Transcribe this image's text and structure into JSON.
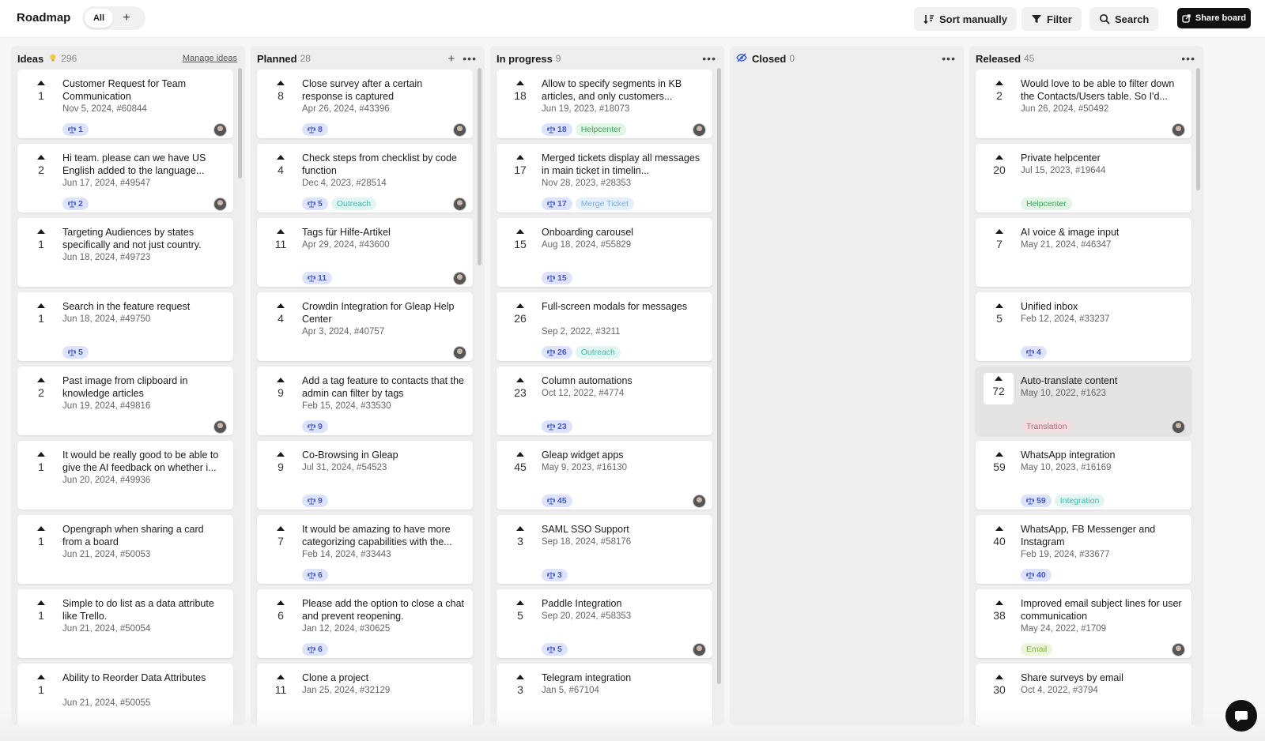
{
  "app": {
    "title": "Roadmap",
    "filter_all": "All",
    "add_symbol": "+",
    "sort_label": "Sort manually",
    "filter_label": "Filter",
    "search_label": "Search",
    "share_label": "Share board"
  },
  "colors": {
    "chip_bg": "#dde3fb",
    "chip_text": "#4358c9",
    "share_bg": "#111111"
  },
  "columns": [
    {
      "name": "Ideas",
      "count": "296",
      "manage_label": "Manage ideas",
      "cards": [
        {
          "votes": "1",
          "title": "Customer Request for Team Communication",
          "meta": "Nov 5, 2024, #60844",
          "chip": "1",
          "avatar": true
        },
        {
          "votes": "2",
          "title": "Hi team. please can we have US English added to the language...",
          "meta": "Jun 17, 2024, #49547",
          "chip": "2",
          "avatar": true
        },
        {
          "votes": "1",
          "title": "Targeting Audiences by states specifically and not just country.",
          "meta": "Jun 18, 2024, #49723"
        },
        {
          "votes": "1",
          "title": "Search in the feature request",
          "meta": "Jun 18, 2024, #49750",
          "chip": "5"
        },
        {
          "votes": "2",
          "title": "Past image from clipboard in knowledge articles",
          "meta": "Jun 19, 2024, #49816",
          "avatar": true
        },
        {
          "votes": "1",
          "title": "It would be really good to be able to give the AI feedback on whether i...",
          "meta": "Jun 20, 2024, #49936"
        },
        {
          "votes": "1",
          "title": "Opengraph when sharing a card from a board",
          "meta": "Jun 21, 2024, #50053"
        },
        {
          "votes": "1",
          "title": "Simple to do list as a data attribute like Trello.",
          "meta": "Jun 21, 2024, #50054"
        },
        {
          "votes": "1",
          "title": "Ability to Reorder Data Attributes",
          "meta": "Jun 21, 2024, #50055"
        }
      ]
    },
    {
      "name": "Planned",
      "count": "28",
      "cards": [
        {
          "votes": "8",
          "title": "Close survey after a certain response is captured",
          "meta": "Apr 26, 2024, #43396",
          "chip": "8",
          "avatar": true
        },
        {
          "votes": "4",
          "title": "Check steps from checklist by code function",
          "meta": "Dec 4, 2023, #28514",
          "chip": "5",
          "tag": "Outreach",
          "tag_color": "#3fb8a8",
          "tag_bg": "#e3f5f2",
          "avatar": true
        },
        {
          "votes": "11",
          "title": "Tags für Hilfe-Artikel",
          "meta": "Apr 29, 2024, #43600",
          "chip": "11",
          "avatar": true
        },
        {
          "votes": "4",
          "title": "Crowdin Integration for Gleap Help Center",
          "meta": "Apr 3, 2024, #40757",
          "avatar": true
        },
        {
          "votes": "9",
          "title": "Add a tag feature to contacts that the admin can filter by tags",
          "meta": "Feb 15, 2024, #33530",
          "chip": "9"
        },
        {
          "votes": "9",
          "title": "Co-Browsing in Gleap",
          "meta": "Jul 31, 2024, #54523",
          "chip": "9"
        },
        {
          "votes": "7",
          "title": "It would be amazing to have more categorizing capabilities with the...",
          "meta": "Feb 14, 2024, #33443",
          "chip": "6"
        },
        {
          "votes": "6",
          "title": "Please add the option to close a chat and prevent reopening.",
          "meta": "Jan 12, 2024, #30625",
          "chip": "6"
        },
        {
          "votes": "11",
          "title": "Clone a project",
          "meta": "Jan 25, 2024, #32129"
        }
      ]
    },
    {
      "name": "In progress",
      "count": "9",
      "cards": [
        {
          "votes": "18",
          "title": "Allow to specify segments in KB articles, and only customers...",
          "meta": "Jun 19, 2023, #18073",
          "chip": "18",
          "tag": "Helpcenter",
          "tag_color": "#3aa55a",
          "tag_bg": "#e2f5e6",
          "avatar": true
        },
        {
          "votes": "17",
          "title": "Merged tickets display all messages in main ticket in timelin...",
          "meta": "Nov 28, 2023, #28353",
          "chip": "17",
          "tag": "Merge Ticket",
          "tag_color": "#7aaee0",
          "tag_bg": "#e6f0fa"
        },
        {
          "votes": "15",
          "title": "Onboarding carousel",
          "meta": "Aug 18, 2024, #55829",
          "chip": "15"
        },
        {
          "votes": "26",
          "title": "Full-screen modals for messages",
          "meta": "Sep 2, 2022, #3211",
          "chip": "26",
          "tag": "Outreach",
          "tag_color": "#3fb8a8",
          "tag_bg": "#e3f5f2"
        },
        {
          "votes": "23",
          "title": "Column automations",
          "meta": "Oct 12, 2022, #4774",
          "chip": "23"
        },
        {
          "votes": "45",
          "title": "Gleap widget apps",
          "meta": "May 9, 2023, #16130",
          "chip": "45",
          "avatar": true
        },
        {
          "votes": "3",
          "title": "SAML SSO Support",
          "meta": "Sep 18, 2024, #58176",
          "chip": "3"
        },
        {
          "votes": "5",
          "title": "Paddle Integration",
          "meta": "Sep 20, 2024, #58353",
          "chip": "5",
          "avatar": true
        },
        {
          "votes": "3",
          "title": "Telegram integration",
          "meta": "Jan 5, #67104"
        }
      ]
    },
    {
      "name": "Closed",
      "count": "0",
      "cards": []
    },
    {
      "name": "Released",
      "count": "45",
      "cards": [
        {
          "votes": "2",
          "title": "Would love to be able to filter down the Contacts/Users table. So I'd...",
          "meta": "Jun 26, 2024, #50492",
          "avatar": true
        },
        {
          "votes": "20",
          "title": "Private helpcenter",
          "meta": "Jul 15, 2023, #19644",
          "tag": "Helpcenter",
          "tag_color": "#3aa55a",
          "tag_bg": "#e2f5e6"
        },
        {
          "votes": "7",
          "title": "AI voice & image input",
          "meta": "May 21, 2024, #46347"
        },
        {
          "votes": "5",
          "title": "Unified inbox",
          "meta": "Feb 12, 2024, #33237",
          "chip": "4"
        },
        {
          "votes": "72",
          "title": "Auto-translate content",
          "meta": "May 10, 2022, #1623",
          "tag": "Translation",
          "tag_color": "#b06a7a",
          "tag_bg": "#f1dde2",
          "avatar": true,
          "highlight": true
        },
        {
          "votes": "59",
          "title": "WhatsApp integration",
          "meta": "May 10, 2023, #16169",
          "chip": "59",
          "tag": "Integration",
          "tag_color": "#3fb8a8",
          "tag_bg": "#e3f5f2"
        },
        {
          "votes": "40",
          "title": "WhatsApp, FB Messenger and Instagram",
          "meta": "Feb 19, 2024, #33677",
          "chip": "40"
        },
        {
          "votes": "38",
          "title": "Improved email subject lines for user communication",
          "meta": "May 24, 2022, #1709",
          "tag": "Email",
          "tag_color": "#7fb23a",
          "tag_bg": "#ecf6dc",
          "avatar": true
        },
        {
          "votes": "30",
          "title": "Share surveys by email",
          "meta": "Oct 4, 2022, #3794"
        }
      ]
    }
  ]
}
